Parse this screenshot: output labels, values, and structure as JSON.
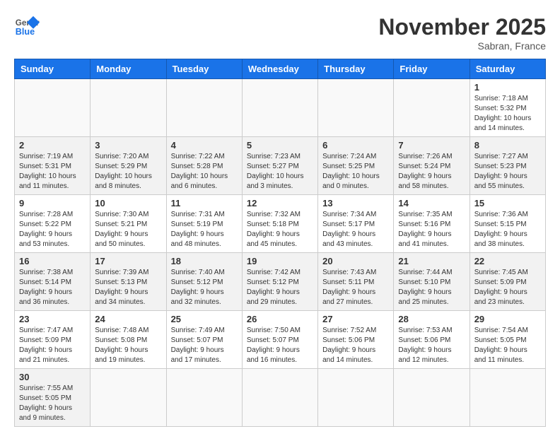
{
  "logo": {
    "general": "General",
    "blue": "Blue"
  },
  "title": "November 2025",
  "location": "Sabran, France",
  "days_header": [
    "Sunday",
    "Monday",
    "Tuesday",
    "Wednesday",
    "Thursday",
    "Friday",
    "Saturday"
  ],
  "weeks": [
    [
      {
        "day": "",
        "info": ""
      },
      {
        "day": "",
        "info": ""
      },
      {
        "day": "",
        "info": ""
      },
      {
        "day": "",
        "info": ""
      },
      {
        "day": "",
        "info": ""
      },
      {
        "day": "",
        "info": ""
      },
      {
        "day": "1",
        "info": "Sunrise: 7:18 AM\nSunset: 5:32 PM\nDaylight: 10 hours and 14 minutes."
      }
    ],
    [
      {
        "day": "2",
        "info": "Sunrise: 7:19 AM\nSunset: 5:31 PM\nDaylight: 10 hours and 11 minutes."
      },
      {
        "day": "3",
        "info": "Sunrise: 7:20 AM\nSunset: 5:29 PM\nDaylight: 10 hours and 8 minutes."
      },
      {
        "day": "4",
        "info": "Sunrise: 7:22 AM\nSunset: 5:28 PM\nDaylight: 10 hours and 6 minutes."
      },
      {
        "day": "5",
        "info": "Sunrise: 7:23 AM\nSunset: 5:27 PM\nDaylight: 10 hours and 3 minutes."
      },
      {
        "day": "6",
        "info": "Sunrise: 7:24 AM\nSunset: 5:25 PM\nDaylight: 10 hours and 0 minutes."
      },
      {
        "day": "7",
        "info": "Sunrise: 7:26 AM\nSunset: 5:24 PM\nDaylight: 9 hours and 58 minutes."
      },
      {
        "day": "8",
        "info": "Sunrise: 7:27 AM\nSunset: 5:23 PM\nDaylight: 9 hours and 55 minutes."
      }
    ],
    [
      {
        "day": "9",
        "info": "Sunrise: 7:28 AM\nSunset: 5:22 PM\nDaylight: 9 hours and 53 minutes."
      },
      {
        "day": "10",
        "info": "Sunrise: 7:30 AM\nSunset: 5:21 PM\nDaylight: 9 hours and 50 minutes."
      },
      {
        "day": "11",
        "info": "Sunrise: 7:31 AM\nSunset: 5:19 PM\nDaylight: 9 hours and 48 minutes."
      },
      {
        "day": "12",
        "info": "Sunrise: 7:32 AM\nSunset: 5:18 PM\nDaylight: 9 hours and 45 minutes."
      },
      {
        "day": "13",
        "info": "Sunrise: 7:34 AM\nSunset: 5:17 PM\nDaylight: 9 hours and 43 minutes."
      },
      {
        "day": "14",
        "info": "Sunrise: 7:35 AM\nSunset: 5:16 PM\nDaylight: 9 hours and 41 minutes."
      },
      {
        "day": "15",
        "info": "Sunrise: 7:36 AM\nSunset: 5:15 PM\nDaylight: 9 hours and 38 minutes."
      }
    ],
    [
      {
        "day": "16",
        "info": "Sunrise: 7:38 AM\nSunset: 5:14 PM\nDaylight: 9 hours and 36 minutes."
      },
      {
        "day": "17",
        "info": "Sunrise: 7:39 AM\nSunset: 5:13 PM\nDaylight: 9 hours and 34 minutes."
      },
      {
        "day": "18",
        "info": "Sunrise: 7:40 AM\nSunset: 5:12 PM\nDaylight: 9 hours and 32 minutes."
      },
      {
        "day": "19",
        "info": "Sunrise: 7:42 AM\nSunset: 5:12 PM\nDaylight: 9 hours and 29 minutes."
      },
      {
        "day": "20",
        "info": "Sunrise: 7:43 AM\nSunset: 5:11 PM\nDaylight: 9 hours and 27 minutes."
      },
      {
        "day": "21",
        "info": "Sunrise: 7:44 AM\nSunset: 5:10 PM\nDaylight: 9 hours and 25 minutes."
      },
      {
        "day": "22",
        "info": "Sunrise: 7:45 AM\nSunset: 5:09 PM\nDaylight: 9 hours and 23 minutes."
      }
    ],
    [
      {
        "day": "23",
        "info": "Sunrise: 7:47 AM\nSunset: 5:09 PM\nDaylight: 9 hours and 21 minutes."
      },
      {
        "day": "24",
        "info": "Sunrise: 7:48 AM\nSunset: 5:08 PM\nDaylight: 9 hours and 19 minutes."
      },
      {
        "day": "25",
        "info": "Sunrise: 7:49 AM\nSunset: 5:07 PM\nDaylight: 9 hours and 17 minutes."
      },
      {
        "day": "26",
        "info": "Sunrise: 7:50 AM\nSunset: 5:07 PM\nDaylight: 9 hours and 16 minutes."
      },
      {
        "day": "27",
        "info": "Sunrise: 7:52 AM\nSunset: 5:06 PM\nDaylight: 9 hours and 14 minutes."
      },
      {
        "day": "28",
        "info": "Sunrise: 7:53 AM\nSunset: 5:06 PM\nDaylight: 9 hours and 12 minutes."
      },
      {
        "day": "29",
        "info": "Sunrise: 7:54 AM\nSunset: 5:05 PM\nDaylight: 9 hours and 11 minutes."
      }
    ],
    [
      {
        "day": "30",
        "info": "Sunrise: 7:55 AM\nSunset: 5:05 PM\nDaylight: 9 hours and 9 minutes."
      },
      {
        "day": "",
        "info": ""
      },
      {
        "day": "",
        "info": ""
      },
      {
        "day": "",
        "info": ""
      },
      {
        "day": "",
        "info": ""
      },
      {
        "day": "",
        "info": ""
      },
      {
        "day": "",
        "info": ""
      }
    ]
  ]
}
